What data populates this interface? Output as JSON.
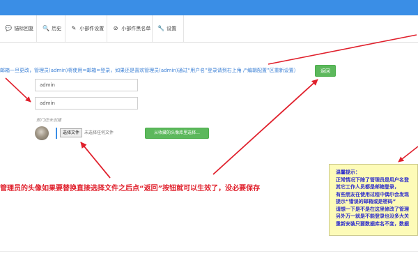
{
  "tabs": [
    {
      "icon": "chat-bubbles-icon",
      "glyph": "💬",
      "label": "锚标回复"
    },
    {
      "icon": "search-icon",
      "glyph": "🔍",
      "label": "历史"
    },
    {
      "icon": "brush-icon",
      "glyph": "✎",
      "label": "小部件设置"
    },
    {
      "icon": "ban-icon",
      "glyph": "⊘",
      "label": "小部件黑名单"
    },
    {
      "icon": "wrench-icon",
      "glyph": "🔧",
      "label": "设置"
    }
  ],
  "notice": "邮箱一旦更改，管理员(admin)将使用=邮箱=登录，如果还是喜欢管理员(admin)通过“用户名”登录请到右上角 /“编辑配置”区重新设置）",
  "return_button": "返回",
  "form": {
    "username_value": "admin",
    "nickname_value": "admin",
    "hint": "部门还未创建",
    "choose_file_label": "选择文件",
    "no_file_text": "未选择任何文件",
    "gallery_button": "从收藏的头像库里选择..."
  },
  "annotation": "管理员的头像如果要替换直接选择文件之后点“返回”按钮就可以生效了，没必要保存",
  "tip": {
    "title": "温馨提示：",
    "lines": [
      "正常情况下除了管理员是用户名登",
      "其它工作人员都是邮箱登录，",
      "有些朋友在使用过程中偶尔会发现",
      "提示“错误的邮箱或是密码”",
      "请想一下是不是在这里修改了管理",
      "另外万一就是不能登录也没多大关",
      "重新安装只要数据库名不变，数据"
    ]
  },
  "colors": {
    "topbar": "#3a8ee6",
    "button_green": "#5cb85c",
    "annotation_red": "#e0202c",
    "tip_bg": "#fdfbb8",
    "tip_text": "#2c2ccc",
    "link_blue": "#3a7fd5"
  }
}
